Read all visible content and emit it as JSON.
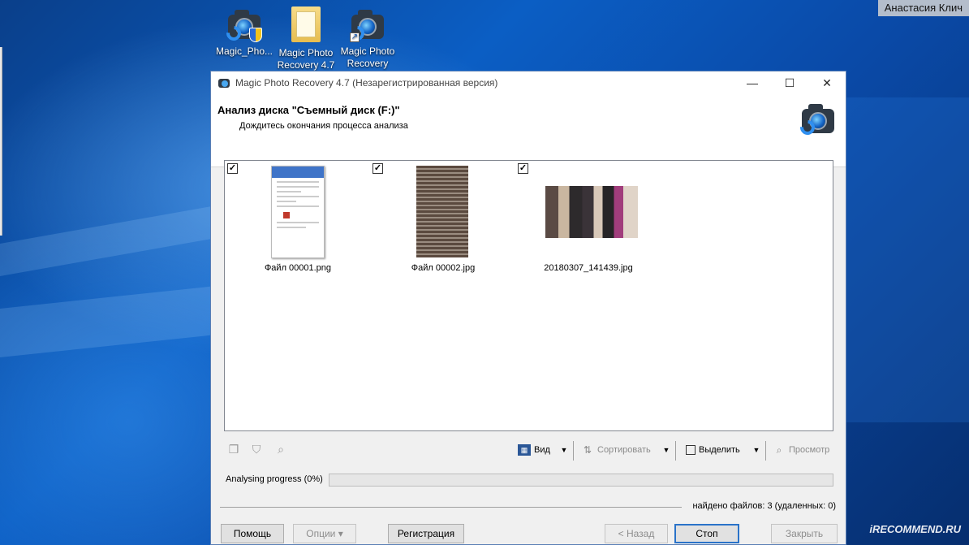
{
  "desktop": {
    "icons": [
      {
        "label_line1": "Magic_Pho...",
        "label_line2": "",
        "icon": "magic-photo-recovery-icon"
      },
      {
        "label_line1": "Magic Photo",
        "label_line2": "Recovery 4.7",
        "icon": "folder-icon"
      },
      {
        "label_line1": "Magic Photo",
        "label_line2": "Recovery",
        "icon": "magic-photo-recovery-shortcut-icon"
      }
    ],
    "user_name": "Анастасия Клич",
    "watermark": "iRECOMMEND.RU"
  },
  "window": {
    "title": "Magic Photo Recovery 4.7 (Незарегистрированная версия)",
    "controls": {
      "minimize": "—",
      "maximize": "☐",
      "close": "✕"
    },
    "header": {
      "title": "Анализ диска \"Съемный диск (F:)\"",
      "subtitle": "Дождитесь окончания процесса анализа"
    },
    "files": [
      {
        "name": "Файл 00001.png",
        "checked": true
      },
      {
        "name": "Файл 00002.jpg",
        "checked": true
      },
      {
        "name": "20180307_141439.jpg",
        "checked": true
      }
    ],
    "toolbar": {
      "view_label": "Вид",
      "sort_label": "Сортировать",
      "select_label": "Выделить",
      "preview_label": "Просмотр"
    },
    "progress": {
      "label": "Analysing progress (0%)",
      "value": 0
    },
    "status": "найдено файлов: 3 (удаленных: 0)",
    "buttons": {
      "help": "Помощь",
      "options": "Опции ▾",
      "register": "Регистрация",
      "back": "< Назад",
      "stop": "Стоп",
      "close": "Закрыть"
    }
  }
}
